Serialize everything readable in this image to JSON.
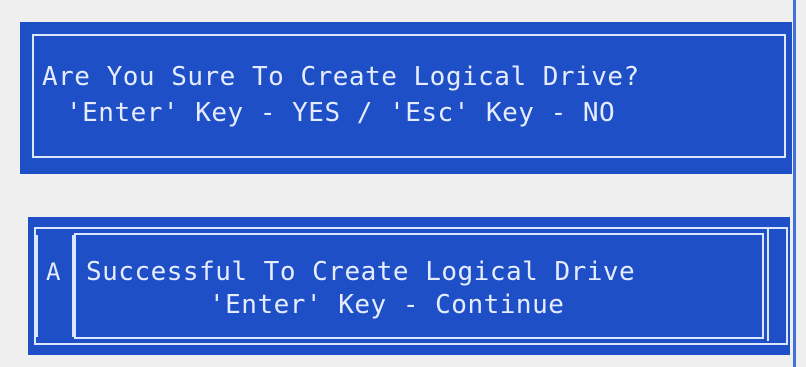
{
  "colors": {
    "panel_blue": "#1e4fc6",
    "text_light": "#e5ecff",
    "frame_light": "#dbe6ff",
    "background": "#efefef"
  },
  "dialogs": [
    {
      "lines": [
        "Are You Sure To Create Logical Drive?",
        "'Enter' Key - YES / 'Esc' Key - NO"
      ]
    },
    {
      "prefix": "A",
      "lines": [
        "Successful To Create Logical Drive",
        "'Enter' Key - Continue"
      ]
    }
  ]
}
